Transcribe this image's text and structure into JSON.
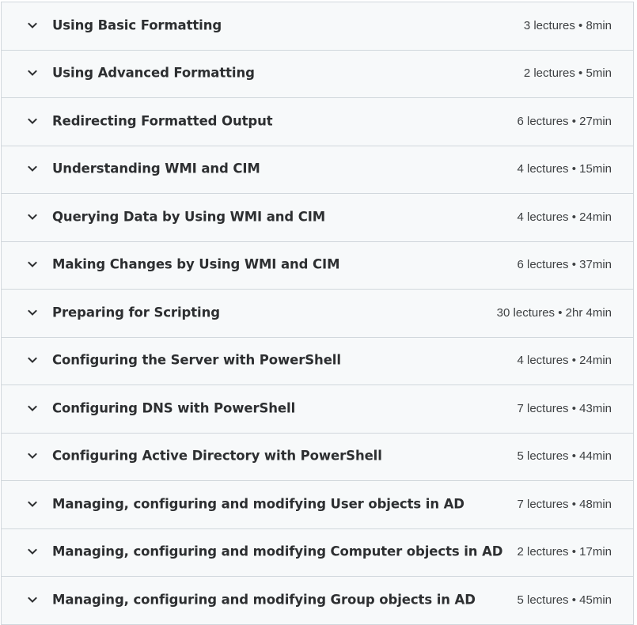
{
  "theme": {
    "row_background": "#f7f9fa",
    "border_color": "#d1d7dc",
    "title_color": "#2d2f31",
    "meta_color": "#3e4143"
  },
  "sections": [
    {
      "title": "Using Basic Formatting",
      "lectures": "3 lectures",
      "duration": "8min",
      "icon": "chevron-down-icon"
    },
    {
      "title": "Using Advanced Formatting",
      "lectures": "2 lectures",
      "duration": "5min",
      "icon": "chevron-down-icon"
    },
    {
      "title": "Redirecting Formatted Output",
      "lectures": "6 lectures",
      "duration": "27min",
      "icon": "chevron-down-icon"
    },
    {
      "title": "Understanding WMI and CIM",
      "lectures": "4 lectures",
      "duration": "15min",
      "icon": "chevron-down-icon"
    },
    {
      "title": "Querying Data by Using WMI and CIM",
      "lectures": "4 lectures",
      "duration": "24min",
      "icon": "chevron-down-icon"
    },
    {
      "title": "Making Changes by Using WMI and CIM",
      "lectures": "6 lectures",
      "duration": "37min",
      "icon": "chevron-down-icon"
    },
    {
      "title": "Preparing for Scripting",
      "lectures": "30 lectures",
      "duration": "2hr 4min",
      "icon": "chevron-down-icon"
    },
    {
      "title": "Configuring the Server with PowerShell",
      "lectures": "4 lectures",
      "duration": "24min",
      "icon": "chevron-down-icon"
    },
    {
      "title": "Configuring DNS with PowerShell",
      "lectures": "7 lectures",
      "duration": "43min",
      "icon": "chevron-down-icon"
    },
    {
      "title": "Configuring Active Directory with PowerShell",
      "lectures": "5 lectures",
      "duration": "44min",
      "icon": "chevron-down-icon"
    },
    {
      "title": "Managing, configuring and modifying User objects in AD",
      "lectures": "7 lectures",
      "duration": "48min",
      "icon": "chevron-down-icon"
    },
    {
      "title": "Managing, configuring and modifying Computer objects in AD",
      "lectures": "2 lectures",
      "duration": "17min",
      "icon": "chevron-down-icon"
    },
    {
      "title": "Managing, configuring and modifying Group objects in AD",
      "lectures": "5 lectures",
      "duration": "45min",
      "icon": "chevron-down-icon"
    }
  ],
  "separator": " • "
}
